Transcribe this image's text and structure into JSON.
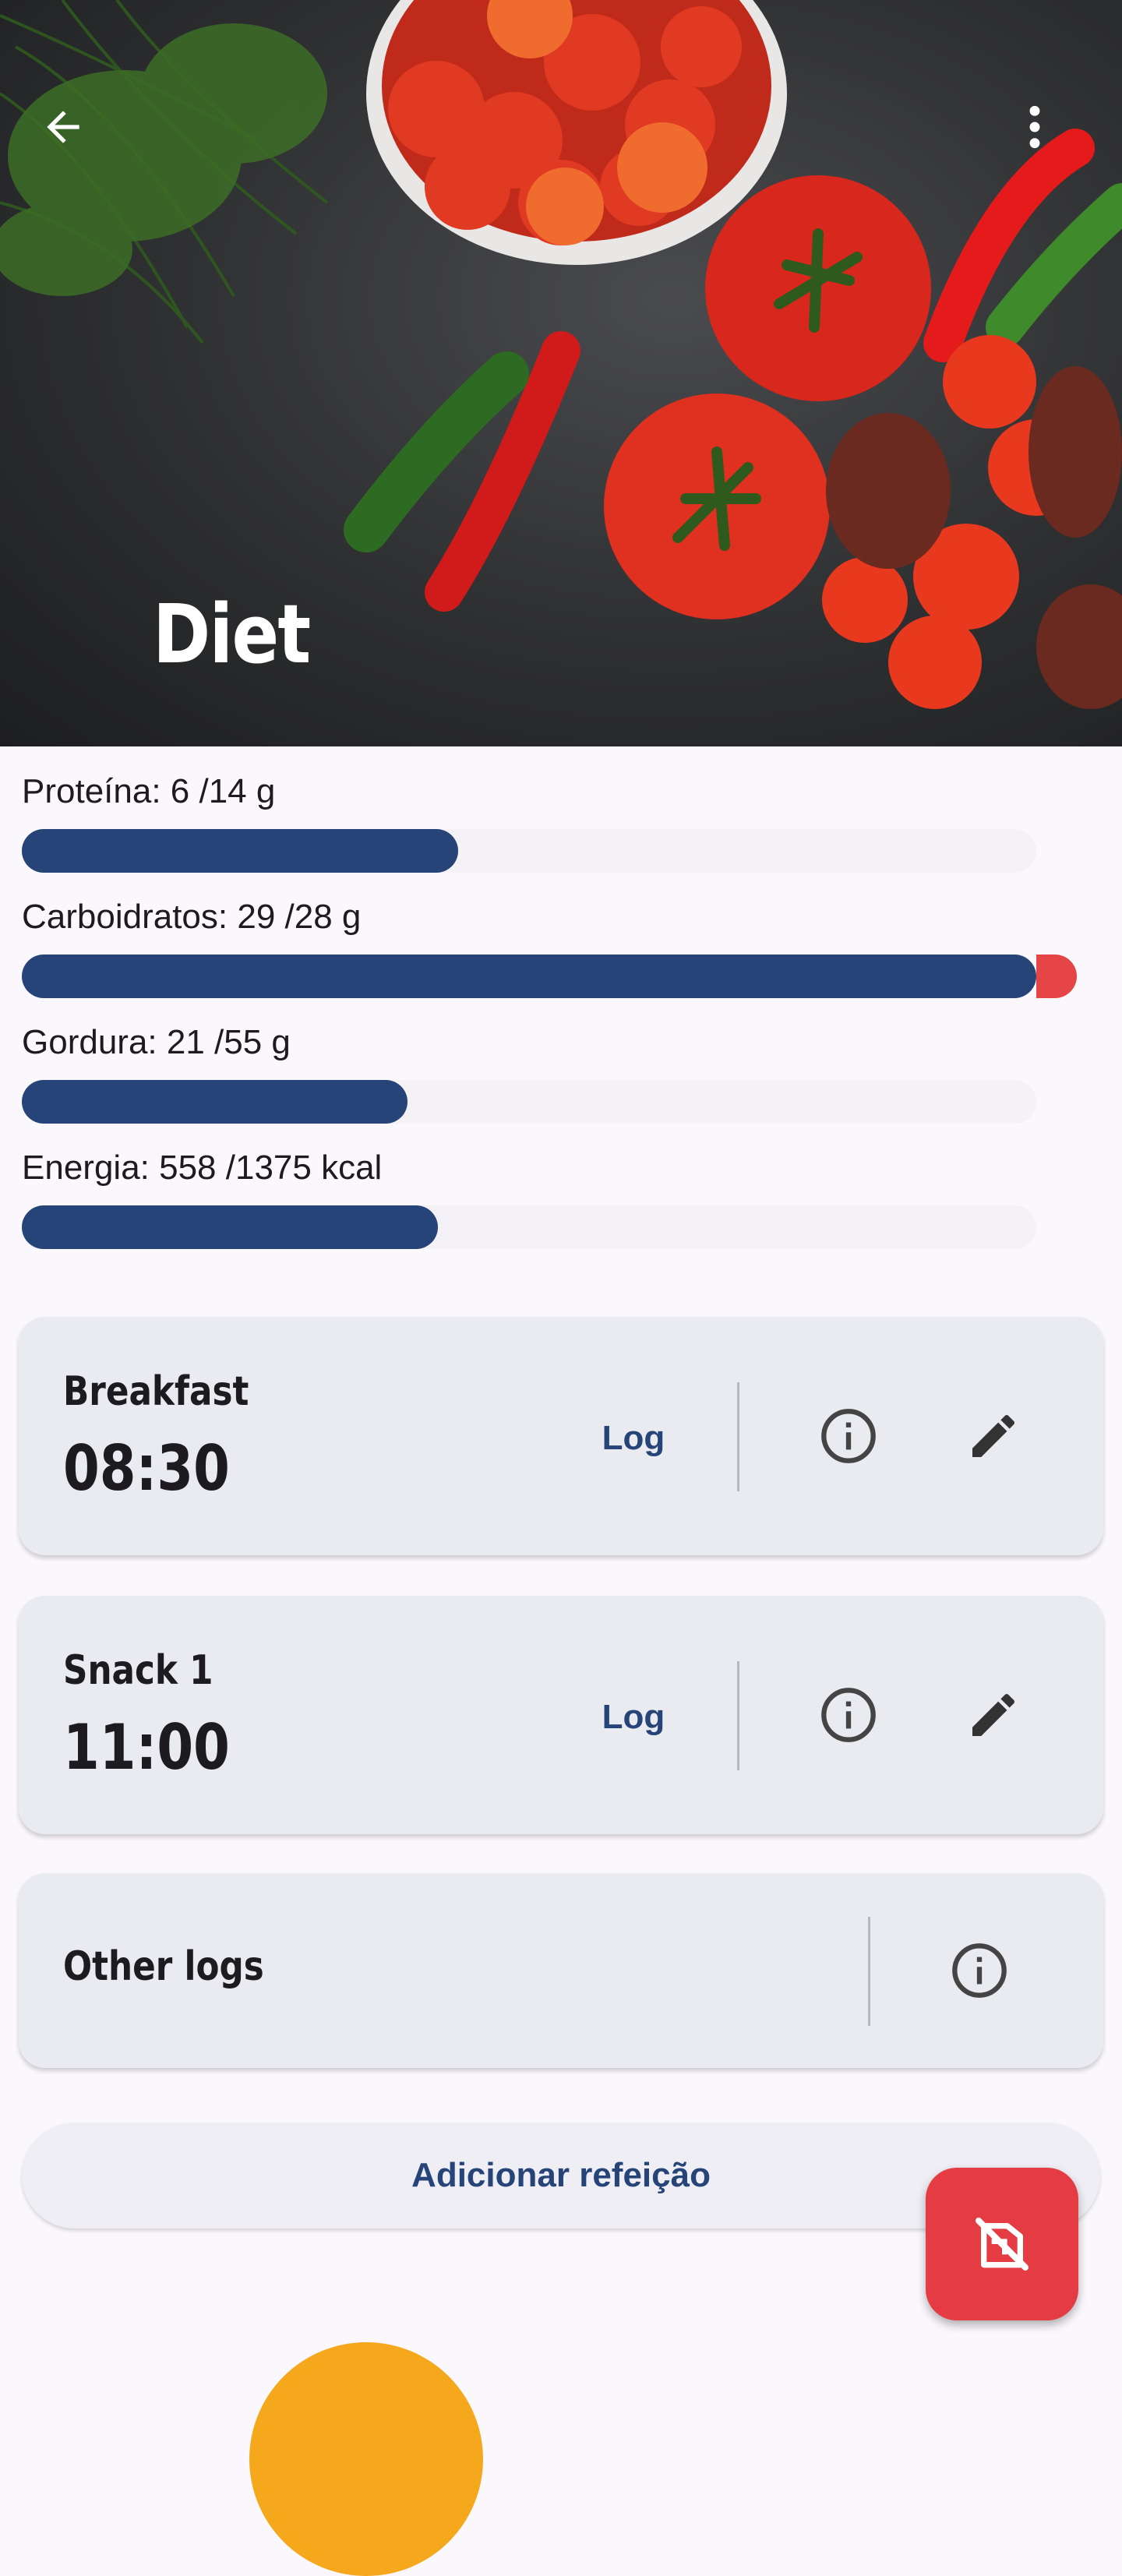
{
  "header": {
    "title": "Diet",
    "back_icon": "arrow-back-icon",
    "menu_icon": "more-vert-icon"
  },
  "nutrients": [
    {
      "label": "Proteína: 6 /14 g",
      "progress": 0.43,
      "over": 0
    },
    {
      "label": "Carboidratos: 29 /28 g",
      "progress": 1.0,
      "over": 0.04
    },
    {
      "label": "Gordura: 21 /55 g",
      "progress": 0.38,
      "over": 0
    },
    {
      "label": "Energia: 558 /1375 kcal",
      "progress": 0.41,
      "over": 0
    }
  ],
  "meals": [
    {
      "name": "Breakfast",
      "time": "08:30",
      "log_label": "Log"
    },
    {
      "name": "Snack 1",
      "time": "11:00",
      "log_label": "Log"
    }
  ],
  "other_logs": {
    "label": "Other logs"
  },
  "add_meal_label": "Adicionar refeição",
  "colors": {
    "primary": "#264478",
    "over_limit": "#e64545",
    "fab": "#e53c43",
    "card": "#e9ebf0"
  }
}
